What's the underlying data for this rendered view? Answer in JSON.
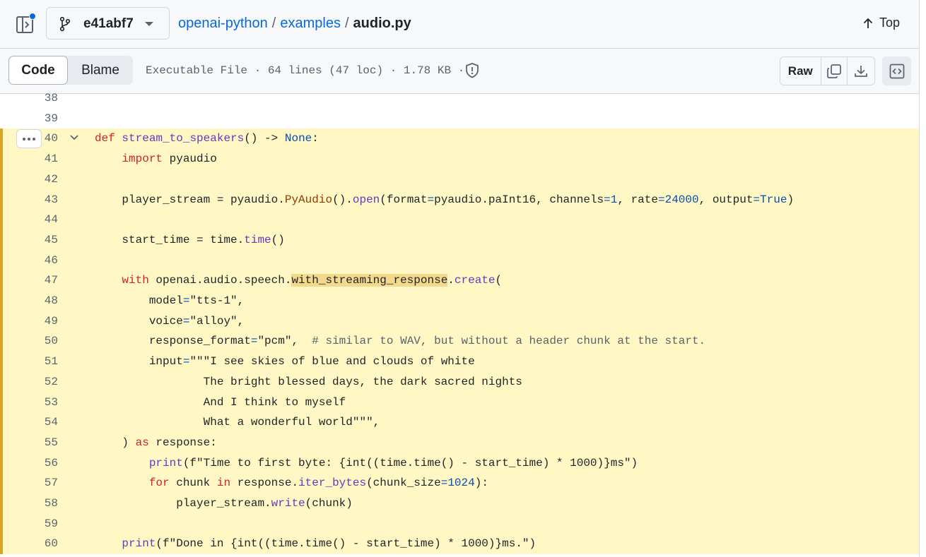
{
  "topbar": {
    "branch": "e41abf7",
    "crumbs": [
      "openai-python",
      "examples"
    ],
    "file": "audio.py",
    "top_label": "Top"
  },
  "filebar": {
    "tab_code": "Code",
    "tab_blame": "Blame",
    "info": "Executable File · 64 lines (47 loc) · 1.78 KB ·",
    "raw_label": "Raw"
  },
  "colors": {
    "highlight_bg": "#fff8c5",
    "highlight_border": "#d4a72c",
    "link": "#0969da"
  },
  "code": {
    "highlight_start": 40,
    "lines": [
      {
        "n": "38",
        "t": ""
      },
      {
        "n": "39",
        "t": ""
      },
      {
        "n": "40",
        "t": "def stream_to_speakers() -> None:"
      },
      {
        "n": "41",
        "t": "    import pyaudio"
      },
      {
        "n": "42",
        "t": ""
      },
      {
        "n": "43",
        "t": "    player_stream = pyaudio.PyAudio().open(format=pyaudio.paInt16, channels=1, rate=24000, output=True)"
      },
      {
        "n": "44",
        "t": ""
      },
      {
        "n": "45",
        "t": "    start_time = time.time()"
      },
      {
        "n": "46",
        "t": ""
      },
      {
        "n": "47",
        "t": "    with openai.audio.speech.with_streaming_response.create("
      },
      {
        "n": "48",
        "t": "        model=\"tts-1\","
      },
      {
        "n": "49",
        "t": "        voice=\"alloy\","
      },
      {
        "n": "50",
        "t": "        response_format=\"pcm\",  # similar to WAV, but without a header chunk at the start."
      },
      {
        "n": "51",
        "t": "        input=\"\"\"I see skies of blue and clouds of white"
      },
      {
        "n": "52",
        "t": "                The bright blessed days, the dark sacred nights"
      },
      {
        "n": "53",
        "t": "                And I think to myself"
      },
      {
        "n": "54",
        "t": "                What a wonderful world\"\"\","
      },
      {
        "n": "55",
        "t": "    ) as response:"
      },
      {
        "n": "56",
        "t": "        print(f\"Time to first byte: {int((time.time() - start_time) * 1000)}ms\")"
      },
      {
        "n": "57",
        "t": "        for chunk in response.iter_bytes(chunk_size=1024):"
      },
      {
        "n": "58",
        "t": "            player_stream.write(chunk)"
      },
      {
        "n": "59",
        "t": ""
      },
      {
        "n": "60",
        "t": "    print(f\"Done in {int((time.time() - start_time) * 1000)}ms.\")"
      }
    ]
  }
}
